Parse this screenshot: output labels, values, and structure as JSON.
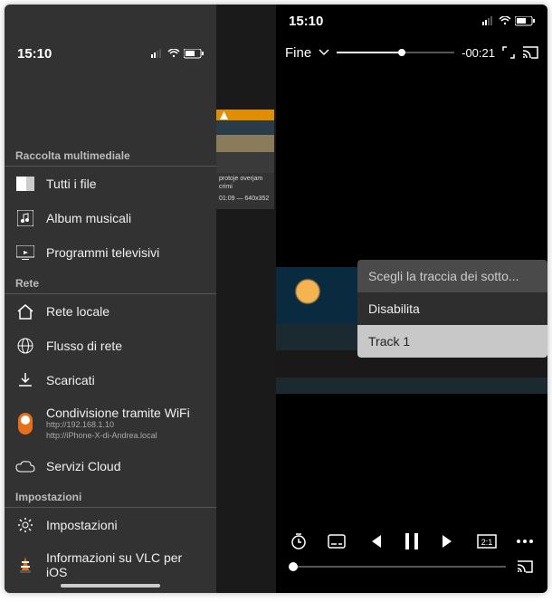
{
  "statusbar": {
    "time": "15:10"
  },
  "left": {
    "sections": {
      "media": {
        "header": "Raccolta multimediale",
        "all_files": "Tutti i file",
        "albums": "Album musicali",
        "tv": "Programmi televisivi"
      },
      "network": {
        "header": "Rete",
        "local": "Rete locale",
        "stream": "Flusso di rete",
        "downloads": "Scaricati",
        "wifi": {
          "label": "Condivisione tramite WiFi",
          "line1": "http://192.168.1.10",
          "line2": "http://iPhone-X-di-Andrea.local"
        },
        "cloud": "Servizi Cloud"
      },
      "settings": {
        "header": "Impostazioni",
        "settings": "Impostazioni",
        "about": "Informazioni su VLC per iOS"
      }
    },
    "thumb": {
      "title": "protoje overjam crimi",
      "meta": "01:09 — 640x352"
    }
  },
  "player": {
    "done": "Fine",
    "time_remaining": "-00:21",
    "subtitle_menu": {
      "title": "Scegli la traccia dei sotto...",
      "disable": "Disabilita",
      "track1": "Track 1"
    }
  }
}
